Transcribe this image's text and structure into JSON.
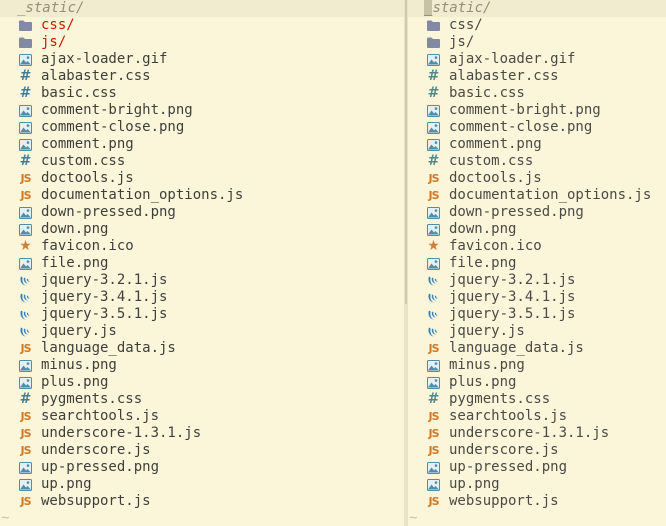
{
  "left": {
    "path": "_static/",
    "items": [
      {
        "name": "css/",
        "icon": "folder"
      },
      {
        "name": "js/",
        "icon": "folder"
      },
      {
        "name": "ajax-loader.gif",
        "icon": "image"
      },
      {
        "name": "alabaster.css",
        "icon": "css"
      },
      {
        "name": "basic.css",
        "icon": "css"
      },
      {
        "name": "comment-bright.png",
        "icon": "image"
      },
      {
        "name": "comment-close.png",
        "icon": "image"
      },
      {
        "name": "comment.png",
        "icon": "image"
      },
      {
        "name": "custom.css",
        "icon": "css"
      },
      {
        "name": "doctools.js",
        "icon": "js"
      },
      {
        "name": "documentation_options.js",
        "icon": "js"
      },
      {
        "name": "down-pressed.png",
        "icon": "image"
      },
      {
        "name": "down.png",
        "icon": "image"
      },
      {
        "name": "favicon.ico",
        "icon": "star"
      },
      {
        "name": "file.png",
        "icon": "image"
      },
      {
        "name": "jquery-3.2.1.js",
        "icon": "jquery"
      },
      {
        "name": "jquery-3.4.1.js",
        "icon": "jquery"
      },
      {
        "name": "jquery-3.5.1.js",
        "icon": "jquery"
      },
      {
        "name": "jquery.js",
        "icon": "jquery"
      },
      {
        "name": "language_data.js",
        "icon": "js"
      },
      {
        "name": "minus.png",
        "icon": "image"
      },
      {
        "name": "plus.png",
        "icon": "image"
      },
      {
        "name": "pygments.css",
        "icon": "css"
      },
      {
        "name": "searchtools.js",
        "icon": "js"
      },
      {
        "name": "underscore-1.3.1.js",
        "icon": "js"
      },
      {
        "name": "underscore.js",
        "icon": "js"
      },
      {
        "name": "up-pressed.png",
        "icon": "image"
      },
      {
        "name": "up.png",
        "icon": "image"
      },
      {
        "name": "websupport.js",
        "icon": "js"
      }
    ]
  },
  "right": {
    "path_cursor": "_",
    "path_rest": "static/",
    "items": [
      {
        "name": "css/",
        "icon": "folder"
      },
      {
        "name": "js/",
        "icon": "folder"
      },
      {
        "name": "ajax-loader.gif",
        "icon": "image"
      },
      {
        "name": "alabaster.css",
        "icon": "css"
      },
      {
        "name": "basic.css",
        "icon": "css"
      },
      {
        "name": "comment-bright.png",
        "icon": "image"
      },
      {
        "name": "comment-close.png",
        "icon": "image"
      },
      {
        "name": "comment.png",
        "icon": "image"
      },
      {
        "name": "custom.css",
        "icon": "css"
      },
      {
        "name": "doctools.js",
        "icon": "js"
      },
      {
        "name": "documentation_options.js",
        "icon": "js"
      },
      {
        "name": "down-pressed.png",
        "icon": "image"
      },
      {
        "name": "down.png",
        "icon": "image"
      },
      {
        "name": "favicon.ico",
        "icon": "star"
      },
      {
        "name": "file.png",
        "icon": "image"
      },
      {
        "name": "jquery-3.2.1.js",
        "icon": "jquery"
      },
      {
        "name": "jquery-3.4.1.js",
        "icon": "jquery"
      },
      {
        "name": "jquery-3.5.1.js",
        "icon": "jquery"
      },
      {
        "name": "jquery.js",
        "icon": "jquery"
      },
      {
        "name": "language_data.js",
        "icon": "js"
      },
      {
        "name": "minus.png",
        "icon": "image"
      },
      {
        "name": "plus.png",
        "icon": "image"
      },
      {
        "name": "pygments.css",
        "icon": "css"
      },
      {
        "name": "searchtools.js",
        "icon": "js"
      },
      {
        "name": "underscore-1.3.1.js",
        "icon": "js"
      },
      {
        "name": "underscore.js",
        "icon": "js"
      },
      {
        "name": "up-pressed.png",
        "icon": "image"
      },
      {
        "name": "up.png",
        "icon": "image"
      },
      {
        "name": "websupport.js",
        "icon": "js"
      }
    ]
  },
  "icon_glyphs": {
    "css": "#",
    "js": "JS",
    "star": "★"
  },
  "empty_line_marker": "~",
  "colors": {
    "background": "#fbf6da",
    "header": "#f1ebcf",
    "directory": "#c91b00",
    "css_icon": "#3f7e9b",
    "js_icon": "#d07a25",
    "image_icon": "#4d8ea8",
    "folder_icon": "#8289a6",
    "jquery_icon": "#3b7fb0"
  }
}
